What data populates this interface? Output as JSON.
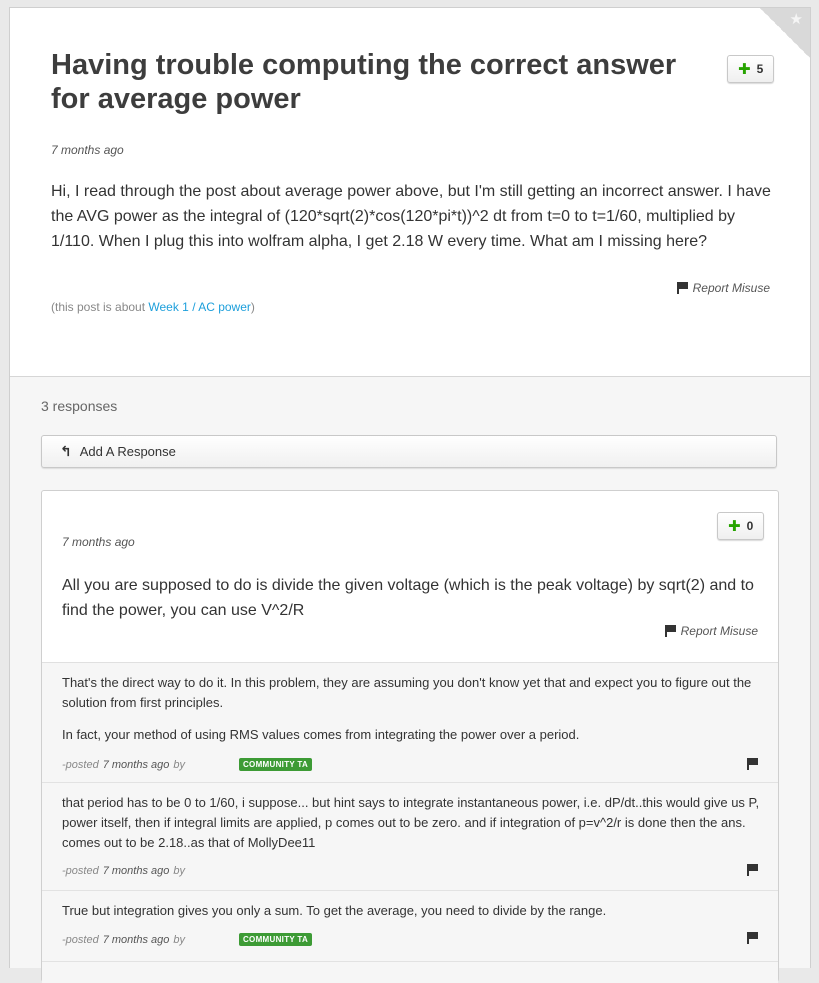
{
  "post": {
    "title": "Having trouble computing the correct answer for average power",
    "votes": "5",
    "timestamp": "7 months ago",
    "body": "Hi, I read through the post about average power above, but I'm still getting an incorrect answer. I have the AVG power as the integral of (120*sqrt(2)*cos(120*pi*t))^2 dt from t=0 to t=1/60, multiplied by 1/110. When I plug this into wolfram alpha, I get 2.18 W every time. What am I missing here?",
    "report_label": "Report Misuse",
    "about_prefix": "(this post is about ",
    "about_link": "Week 1 / AC power",
    "about_suffix": ")"
  },
  "responses_count": "3 responses",
  "add_response_label": "Add A Response",
  "response": {
    "votes": "0",
    "timestamp": "7 months ago",
    "body": "All you are supposed to do is divide the given voltage (which is the peak voltage) by sqrt(2) and to find the power, you can use V^2/R",
    "report_label": "Report Misuse"
  },
  "comments": [
    {
      "para1": "That's the direct way to do it. In this problem, they are assuming you don't know yet that and expect you to figure out the solution from first principles.",
      "para2": "In fact, your method of using RMS values comes from integrating the power over a period.",
      "posted": "-posted",
      "time": "7 months ago",
      "by": "by",
      "badge": "COMMUNITY TA"
    },
    {
      "para1": "that period has to be 0 to 1/60, i suppose... but hint says to integrate instantaneous power, i.e. dP/dt..this would give us P, power itself, then if integral limits are applied, p comes out to be zero. and if integration of p=v^2/r is done then the ans. comes out to be 2.18..as that of MollyDee11",
      "posted": "-posted",
      "time": "7 months ago",
      "by": "by"
    },
    {
      "para1": "True but integration gives you only a sum. To get the average, you need to divide by the range.",
      "posted": "-posted",
      "time": "7 months ago",
      "by": "by",
      "badge": "COMMUNITY TA"
    }
  ]
}
